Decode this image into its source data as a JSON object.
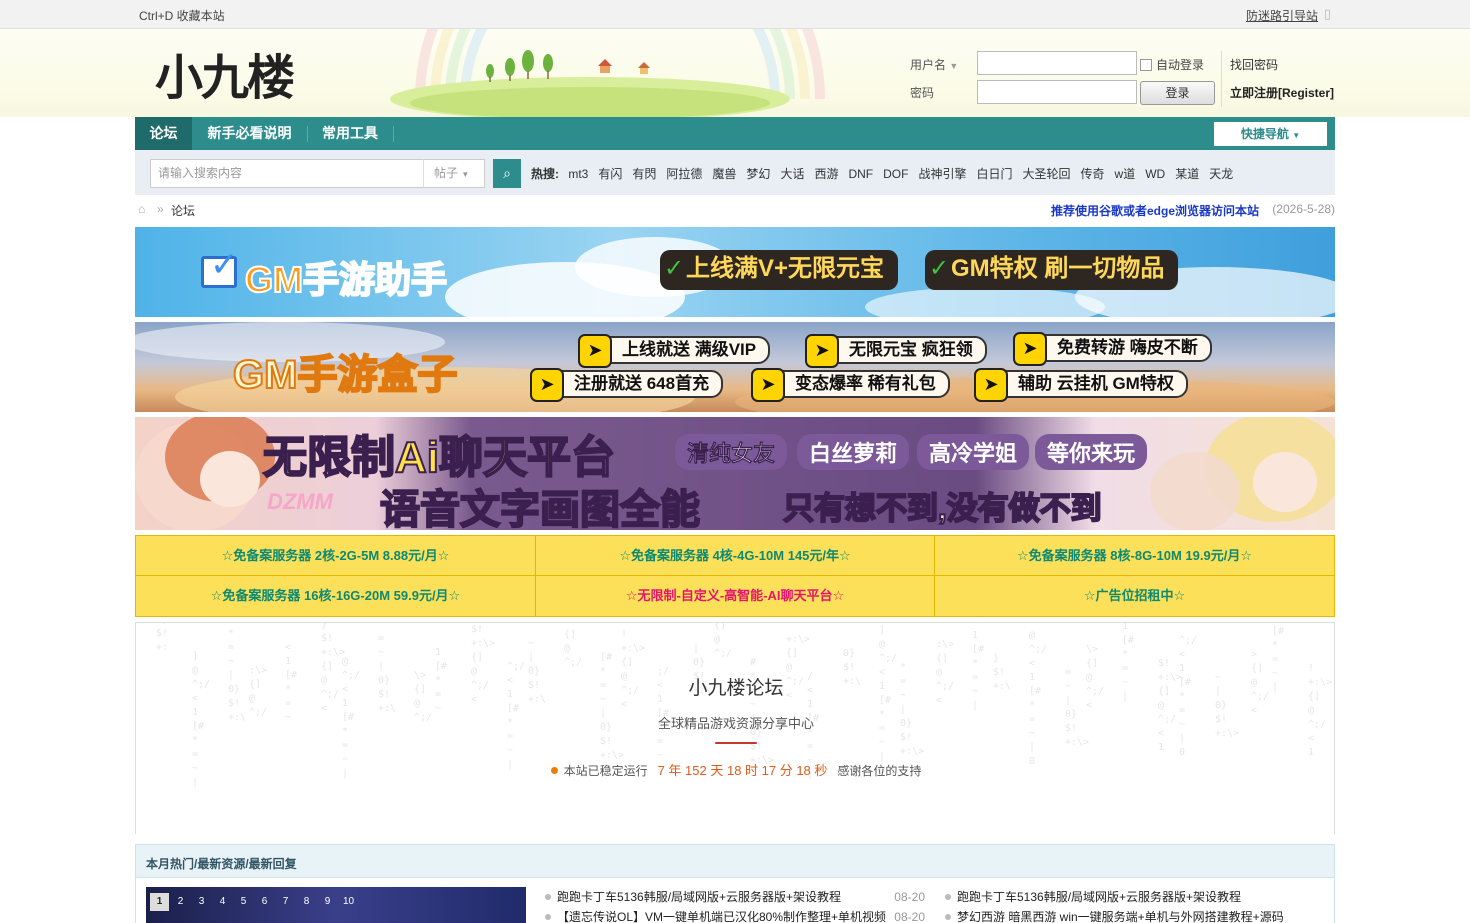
{
  "topbar": {
    "bookmark": "Ctrl+D 收藏本站",
    "anti_lost": "防迷路引导站"
  },
  "logo": {
    "text": "小九楼"
  },
  "login": {
    "username_label": "用户名",
    "password_label": "密码",
    "auto_login": "自动登录",
    "login_button": "登录",
    "find_password": "找回密码",
    "register": "立即注册[Register]"
  },
  "nav": {
    "items": [
      {
        "label": "论坛"
      },
      {
        "label": "新手必看说明"
      },
      {
        "label": "常用工具"
      }
    ],
    "quick_nav": "快捷导航"
  },
  "search": {
    "placeholder": "请输入搜索内容",
    "type": "帖子",
    "hot_label": "热搜:",
    "keywords": [
      "mt3",
      "有闪",
      "有閃",
      "阿拉德",
      "魔兽",
      "梦幻",
      "大话",
      "西游",
      "DNF",
      "DOF",
      "战神引擎",
      "白日门",
      "大圣轮回",
      "传奇",
      "w道",
      "WD",
      "某道",
      "天龙"
    ]
  },
  "breadcrumb": {
    "current": "论坛",
    "notice": "推荐使用谷歌或者edge浏览器访问本站",
    "notice_date": "(2026-5-28)"
  },
  "banner1": {
    "title": "GM手游助手",
    "tag1": "上线满V+无限元宝",
    "tag2": "GM特权 刷一切物品"
  },
  "banner2": {
    "title": "GM手游盒子",
    "pills": [
      "上线就送 满级VIP",
      "无限元宝 疯狂领",
      "免费转游 嗨皮不断",
      "注册就送 648首充",
      "变态爆率 稀有礼包",
      "辅助 云挂机 GM特权"
    ]
  },
  "banner3": {
    "title": "无限制Ai聊天平台",
    "tags": [
      "清纯女友",
      "白丝萝莉",
      "高冷学姐",
      "等你来玩"
    ],
    "brand": "DZMM",
    "line2": "语音文字画图全能",
    "line3": "只有想不到,没有做不到"
  },
  "ads": [
    "☆免备案服务器 2核-2G-5M 8.88元/月☆",
    "☆免备案服务器 4核-4G-10M 145元/年☆",
    "☆免备案服务器 8核-8G-10M 19.9元/月☆",
    "☆免备案服务器 16核-16G-20M 59.9元/月☆",
    "☆无限制-自定义-高智能-AI聊天平台☆",
    "☆广告位招租中☆"
  ],
  "site": {
    "name": "小九楼论坛",
    "slogan": "全球精品游戏资源分享中心",
    "running_label": "本站已稳定运行",
    "running_time": "7 年 152 天 18 时 17 分 18 秒",
    "thanks": "感谢各位的支持"
  },
  "hot": {
    "header": "本月热门/最新资源/最新回复",
    "slide_pages": [
      "1",
      "2",
      "3",
      "4",
      "5",
      "6",
      "7",
      "8",
      "9",
      "10"
    ],
    "list_a": [
      {
        "title": "跑跑卡丁车5136韩服/局域网版+云服务器版+架设教程",
        "date": "08-20"
      },
      {
        "title": "【遗忘传说OL】VM一键单机端已汉化80%制作整理+单机视频",
        "date": "08-20"
      }
    ],
    "list_b": [
      {
        "title": "跑跑卡丁车5136韩服/局域网版+云服务器版+架设教程"
      },
      {
        "title": "梦幻西游 暗黑西游 win一键服务端+单机与外网搭建教程+源码"
      }
    ]
  },
  "colors": {
    "nav_bg": "#2d8c8c",
    "nav_active": "#1f6a6a",
    "ad_bg": "#fde05a",
    "ad_text": "#0d8a71",
    "ad_pink": "#e5156d",
    "notice": "#1a39c7"
  }
}
